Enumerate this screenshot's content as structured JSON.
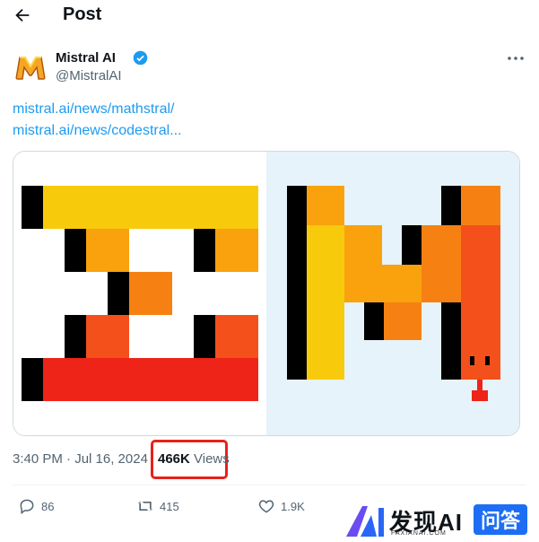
{
  "header": {
    "title": "Post"
  },
  "author": {
    "name": "Mistral AI",
    "handle": "@MistralAI"
  },
  "links": [
    "mistral.ai/news/mathstral/",
    "mistral.ai/news/codestral..."
  ],
  "meta": {
    "timestamp": "3:40 PM · Jul 16, 2024",
    "views_count": "466K",
    "views_label": "Views"
  },
  "actions": {
    "replies": "86",
    "reposts": "415",
    "likes": "1.9K"
  },
  "watermark": {
    "text": "发现AI",
    "sub": "FAXIANAI.COM",
    "badge": "问答"
  },
  "colors": {
    "link": "#1d9bf0",
    "highlight": "#e8211a",
    "verified": "#1d9bf0",
    "media_right_bg": "#e6f3fb"
  },
  "icons": [
    "back-arrow-icon",
    "verified-badge-icon",
    "more-icon",
    "reply-icon",
    "repost-icon",
    "like-icon"
  ]
}
